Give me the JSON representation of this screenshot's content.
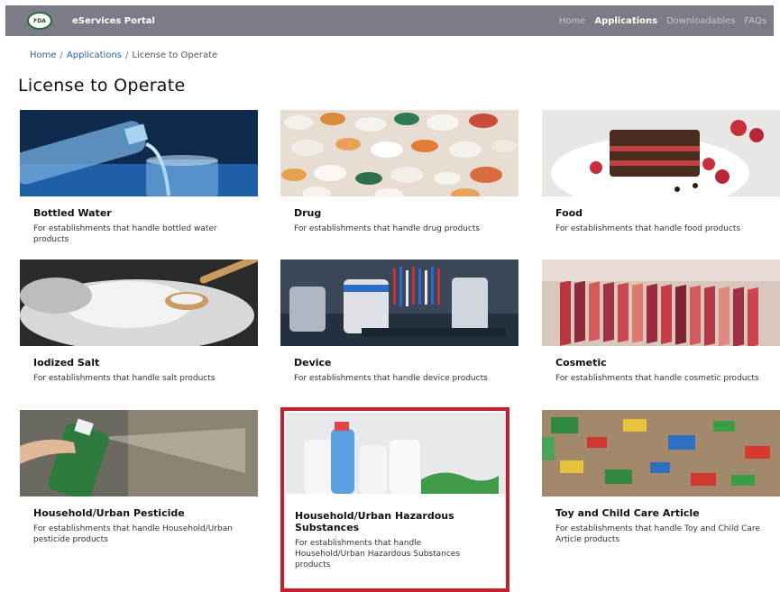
{
  "header": {
    "logo_text": "FDA",
    "portal_title": "eServices Portal",
    "nav": [
      "Home",
      "Applications",
      "Downloadables",
      "FAQs"
    ],
    "active_nav": "Applications"
  },
  "breadcrumb": {
    "home": "Home",
    "applications": "Applications",
    "current": "License to Operate"
  },
  "page_title": "License to Operate",
  "cards": [
    {
      "title": "Bottled Water",
      "desc": "For establishments that handle bottled water products",
      "image": "bottled-water-photo"
    },
    {
      "title": "Drug",
      "desc": "For establishments that handle drug products",
      "image": "pills-photo"
    },
    {
      "title": "Food",
      "desc": "For establishments that handle food products",
      "image": "cake-photo"
    },
    {
      "title": "Iodized Salt",
      "desc": "For establishments that handle salt products",
      "image": "salt-photo"
    },
    {
      "title": "Device",
      "desc": "For establishments that handle device products",
      "image": "lab-device-photo"
    },
    {
      "title": "Cosmetic",
      "desc": "For establishments that handle cosmetic products",
      "image": "lipstick-photo"
    },
    {
      "title": "Household/Urban Pesticide",
      "desc": "For establishments that handle Household/Urban pesticide products",
      "image": "spray-can-photo"
    },
    {
      "title": "Household/Urban Hazardous Substances",
      "desc": "For establishments that handle Household/Urban Hazardous Substances products",
      "image": "cleaning-bottles-photo"
    },
    {
      "title": "Toy and Child Care Article",
      "desc": "For establishments that handle Toy and Child Care Article products",
      "image": "toys-photo"
    }
  ],
  "highlight_color": "#c4202b"
}
